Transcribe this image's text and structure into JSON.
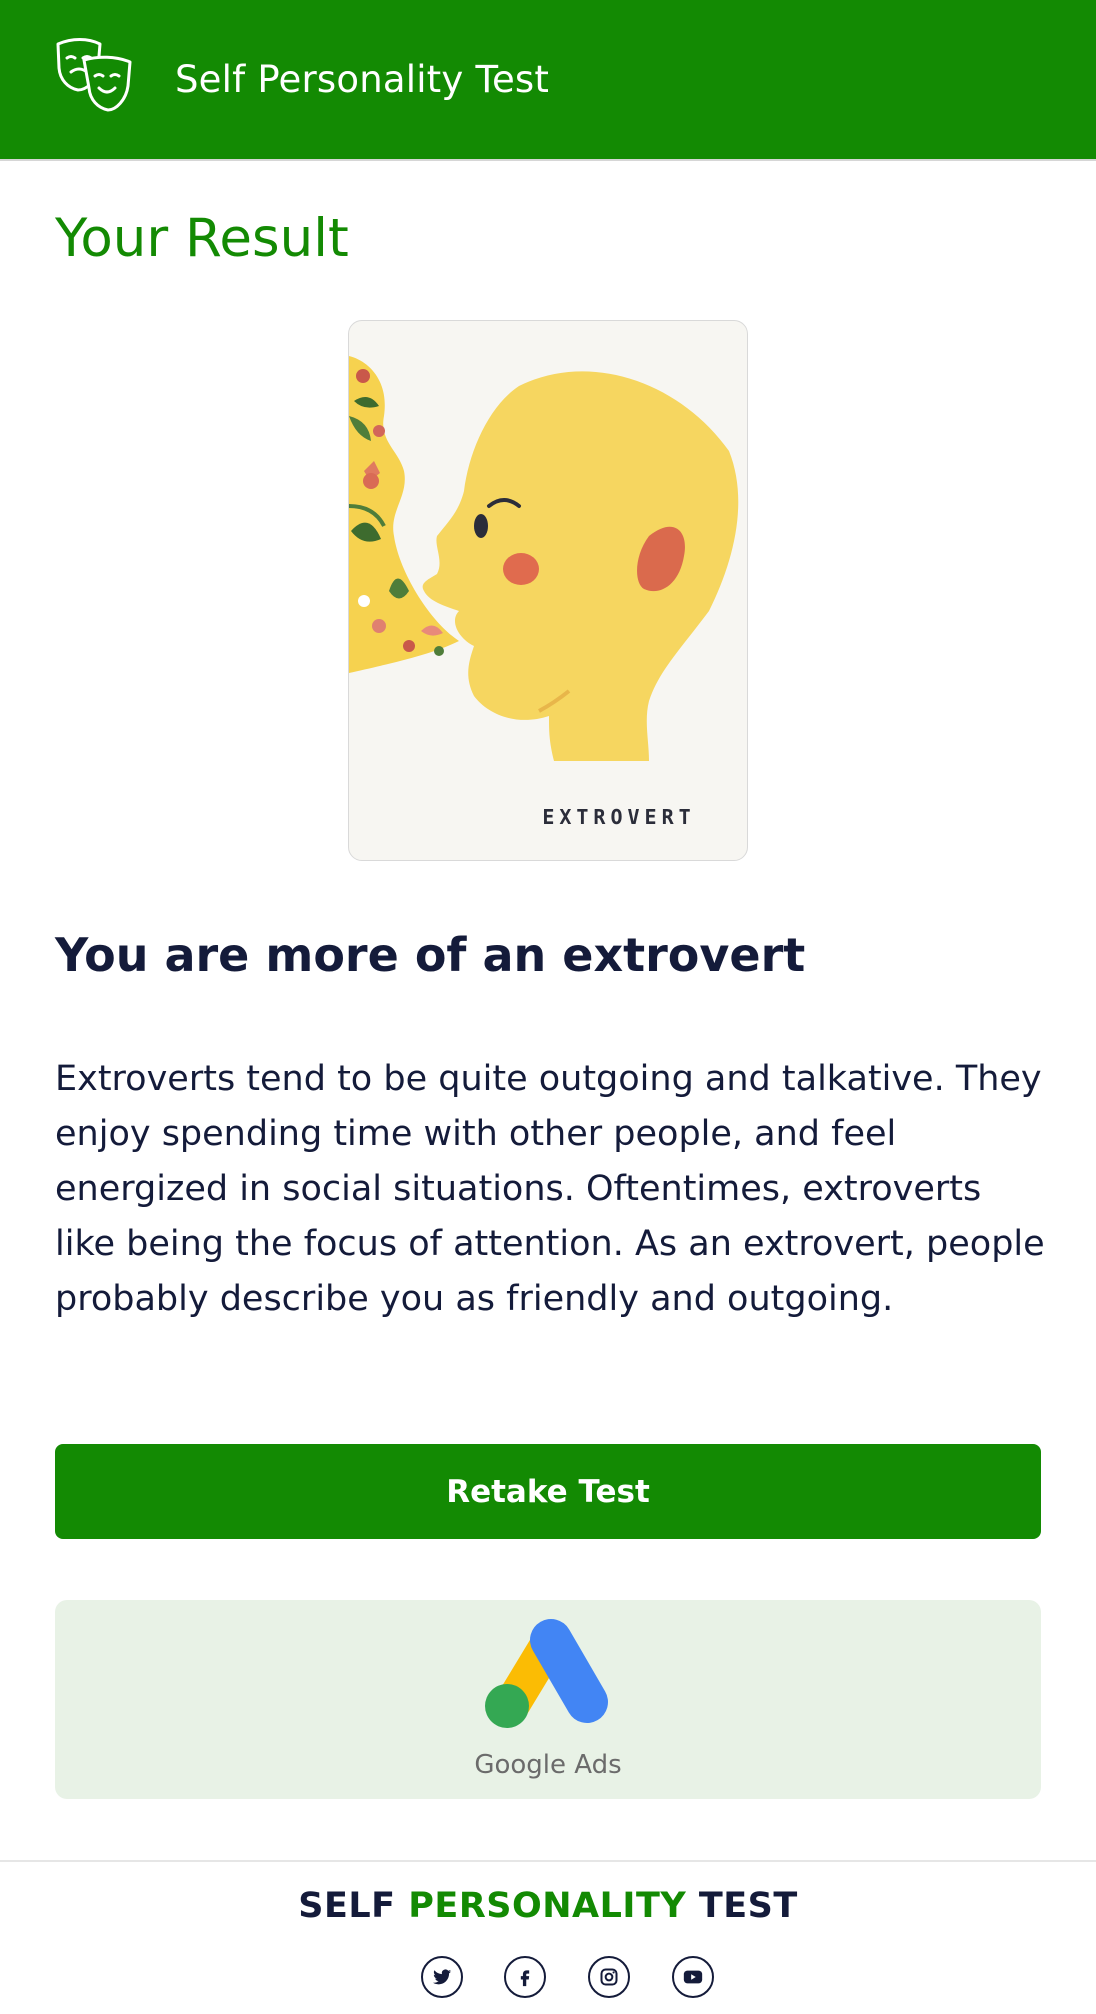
{
  "header": {
    "logo_icon": "theater-masks-icon",
    "title": "Self Personality Test",
    "background": "#138a03"
  },
  "result": {
    "section_title": "Your Result",
    "card_label": "EXTROVERT",
    "headline": "You are more of an extrovert",
    "description": "Extroverts tend to be quite outgoing and talkative. They enjoy spending time with other people, and feel energized in social situations. Oftentimes, extroverts like being the focus of attention. As an extrovert, people probably describe you as friendly and outgoing."
  },
  "actions": {
    "retake_label": "Retake Test"
  },
  "ad": {
    "logo_icon": "google-ads-logo",
    "text": "Google Ads",
    "background": "#e8f2e6"
  },
  "footer": {
    "brand_part1": "SELF ",
    "brand_part2": "PERSONALITY",
    "brand_part3": " TEST",
    "socials": [
      {
        "icon": "twitter-icon"
      },
      {
        "icon": "facebook-icon"
      },
      {
        "icon": "instagram-icon"
      },
      {
        "icon": "youtube-icon"
      }
    ]
  },
  "colors": {
    "accent": "#138a03",
    "text": "#141b3a"
  }
}
